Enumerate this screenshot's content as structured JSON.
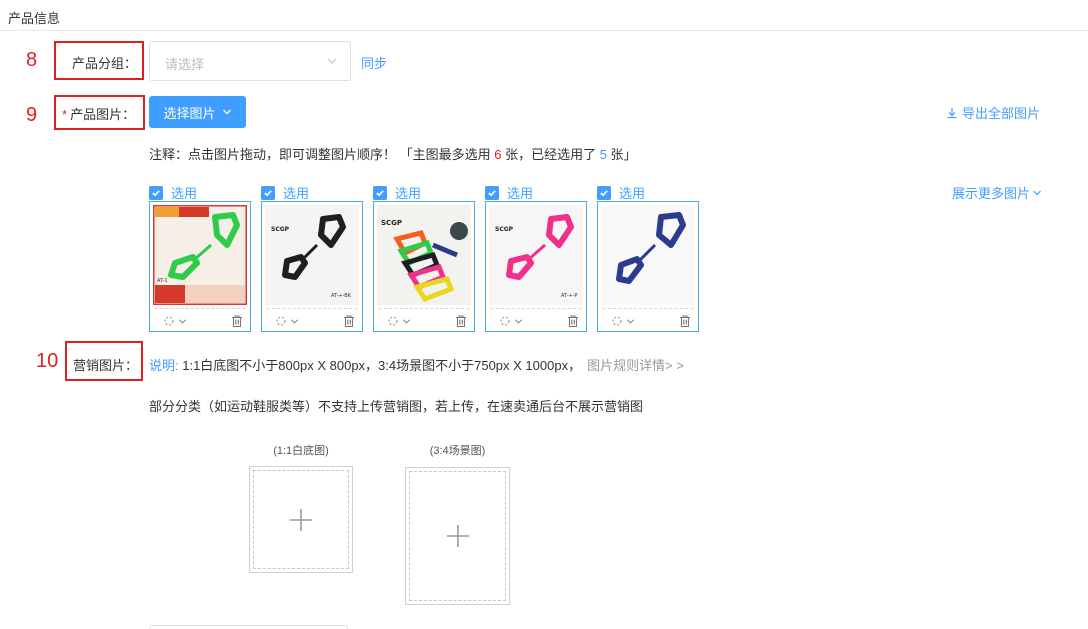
{
  "section": {
    "title": "产品信息"
  },
  "steps": {
    "group": "8",
    "images": "9",
    "marketing": "10"
  },
  "group_field": {
    "label": "产品分组：",
    "placeholder": "请选择",
    "sync": "同步"
  },
  "images_field": {
    "required": "*",
    "label": "产品图片：",
    "select_button": "选择图片",
    "export": "导出全部图片",
    "note_prefix": "注释：点击图片拖动，即可调整图片顺序！ 「主图最多选用 ",
    "max_count": "6",
    "note_mid": " 张，已经选用了 ",
    "used_count": "5",
    "note_suffix": " 张」",
    "show_more": "展示更多图片",
    "thumbs": [
      {
        "check_label": "选用",
        "variant": "green",
        "color": "#2ecc4a",
        "code": "AT-1"
      },
      {
        "check_label": "选用",
        "variant": "black",
        "color": "#1f1f1f",
        "code": "AT-+-BK"
      },
      {
        "check_label": "选用",
        "variant": "multi",
        "color": "#f06020",
        "code": ""
      },
      {
        "check_label": "选用",
        "variant": "pink",
        "color": "#f0308a",
        "code": "AT-+-P"
      },
      {
        "check_label": "选用",
        "variant": "navy",
        "color": "#2c3b8e",
        "code": ""
      }
    ]
  },
  "marketing_field": {
    "label": "营销图片：",
    "note_key": "说明:",
    "note_text": " 1:1白底图不小于800px X 800px，3:4场景图不小于750px X 1000px，",
    "rule_link": "图片规则详情> >",
    "note2": "部分分类（如运动鞋服类等）不支持上传营销图，若上传，在速卖通后台不展示营销图",
    "uploads": [
      {
        "caption": "(1:1白底图)"
      },
      {
        "caption": "(3:4场景图)"
      }
    ]
  },
  "colors": {
    "primary": "#409eff",
    "annotation": "#e02020",
    "thumb_border": "#4aa8e0"
  }
}
